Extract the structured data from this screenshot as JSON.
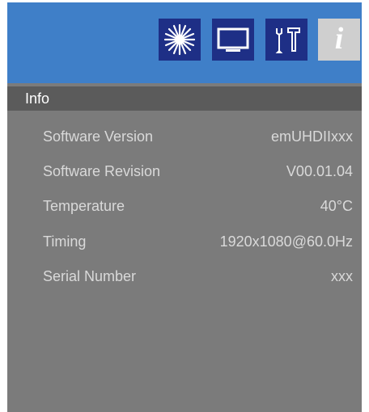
{
  "tabs": [
    {
      "icon": "brightness-icon"
    },
    {
      "icon": "display-icon"
    },
    {
      "icon": "setup-tools-icon"
    },
    {
      "icon": "info-icon",
      "label": "i",
      "active": true
    }
  ],
  "section": {
    "title": "Info"
  },
  "rows": [
    {
      "label": "Software Version",
      "value": "emUHDIIxxx"
    },
    {
      "label": "Software Revision",
      "value": "V00.01.04"
    },
    {
      "label": "Temperature",
      "value": "40°C"
    },
    {
      "label": "Timing",
      "value": "1920x1080@60.0Hz"
    },
    {
      "label": "Serial Number",
      "value": "xxx"
    }
  ],
  "colors": {
    "header_blue": "#3f7fc8",
    "tab_dark": "#1e2f86",
    "tab_active": "#cfcfcf",
    "panel_gray": "#7b7b7b",
    "section_bar": "#5b5b5b",
    "text": "#d9d9d9"
  }
}
